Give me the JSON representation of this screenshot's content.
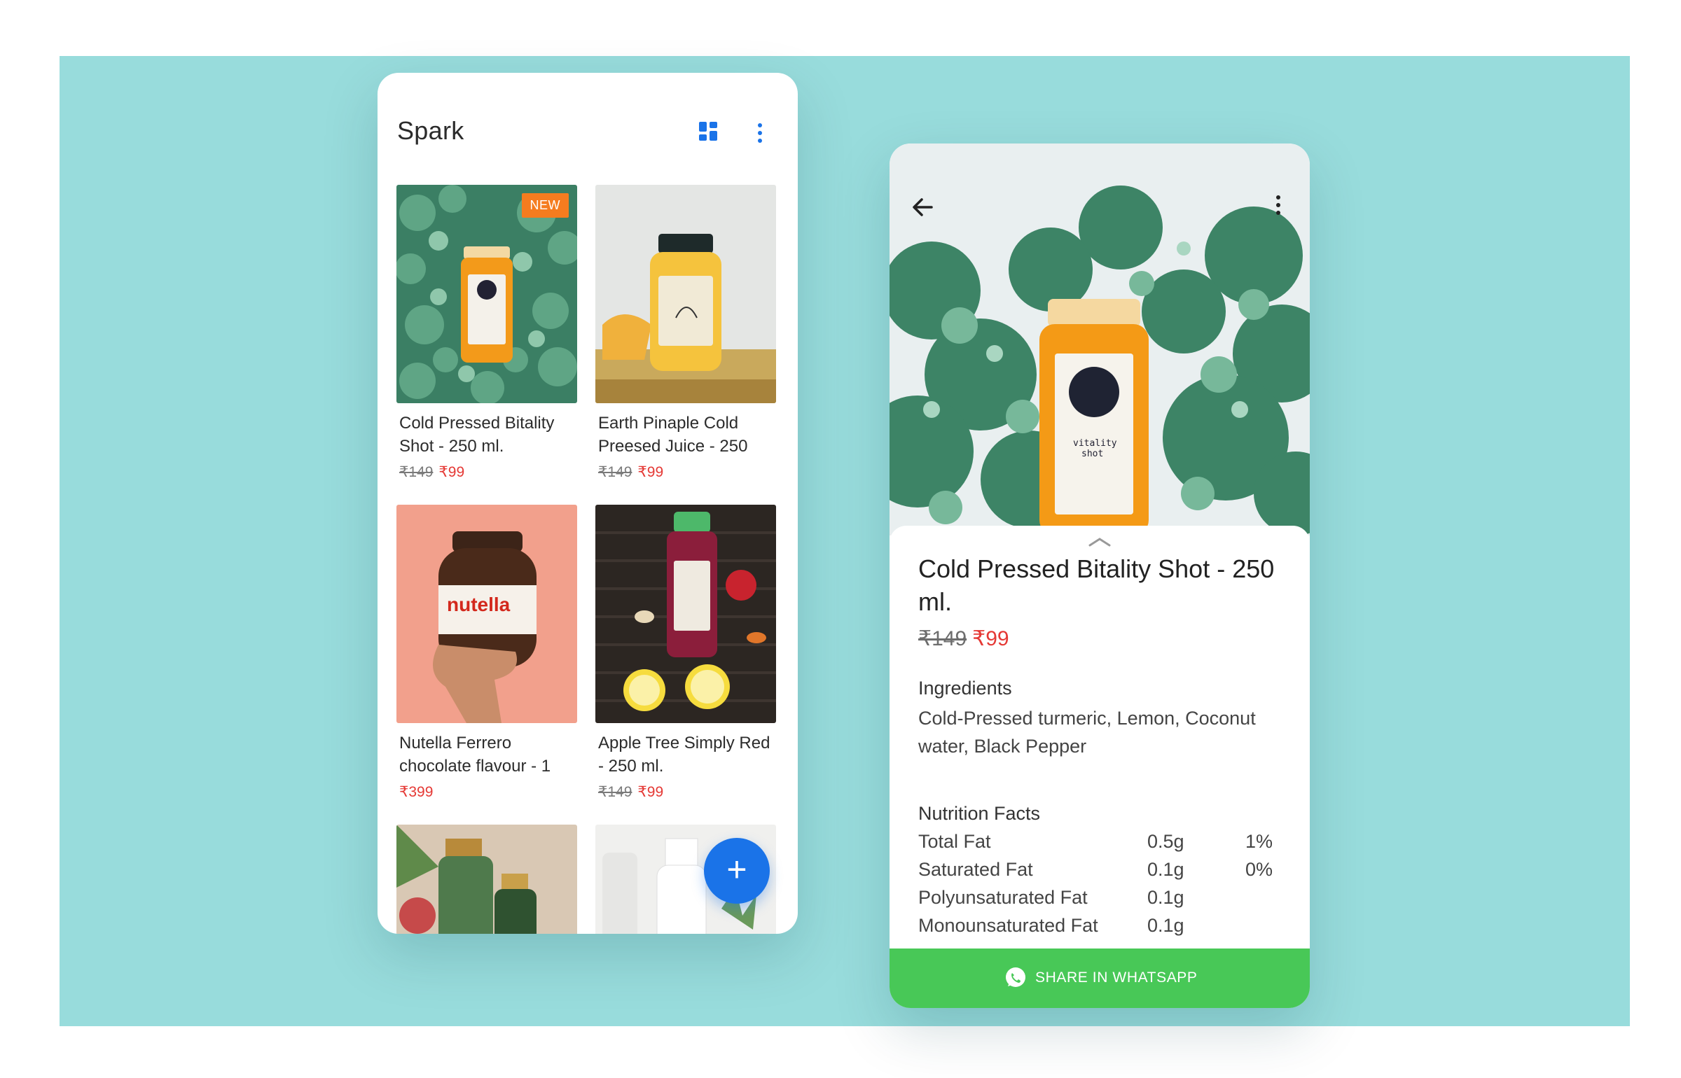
{
  "colors": {
    "background": "#98dcdc",
    "accent_blue": "#1a73e8",
    "price_red": "#e53935",
    "badge_orange": "#f57c1f",
    "whatsapp_green": "#48c857"
  },
  "catalog": {
    "title": "Spark",
    "icons": [
      "grid-view-icon",
      "more-vert-icon"
    ],
    "fab_label": "+",
    "products": [
      {
        "name": "Cold Pressed Bitality Shot - 250 ml.",
        "old_price": "₹149",
        "price": "₹99",
        "badge": "NEW",
        "image": "juice-bottle-leaves-image"
      },
      {
        "name": "Earth Pinaple Cold Preesed Juice - 250",
        "old_price": "₹149",
        "price": "₹99",
        "image": "earth-juice-bottle-image"
      },
      {
        "name": "Nutella Ferrero chocolate flavour - 1",
        "old_price": "",
        "price": "₹399",
        "image": "nutella-jar-image"
      },
      {
        "name": "Apple Tree Simply Red - 250 ml.",
        "old_price": "₹149",
        "price": "₹99",
        "image": "red-juice-bottle-image"
      },
      {
        "name": "",
        "image": "green-bottles-image"
      },
      {
        "name": "",
        "image": "oil-bottles-image"
      }
    ]
  },
  "detail": {
    "icons": [
      "back-arrow-icon",
      "more-vert-icon",
      "chevron-up-icon"
    ],
    "title": "Cold Pressed Bitality Shot - 250 ml.",
    "old_price": "₹149",
    "price": "₹99",
    "ingredients_heading": "Ingredients",
    "ingredients": "Cold-Pressed turmeric, Lemon, Coconut water, Black Pepper",
    "nutrition_heading": "Nutrition Facts",
    "nutrition": [
      {
        "name": "Total Fat",
        "amount": "0.5g",
        "percent": "1%"
      },
      {
        "name": "Saturated Fat",
        "amount": "0.1g",
        "percent": "0%"
      },
      {
        "name": "Polyunsaturated Fat",
        "amount": "0.1g",
        "percent": ""
      },
      {
        "name": "Monounsaturated Fat",
        "amount": "0.1g",
        "percent": ""
      }
    ],
    "share_label": "SHARE IN WHATSAPP"
  }
}
